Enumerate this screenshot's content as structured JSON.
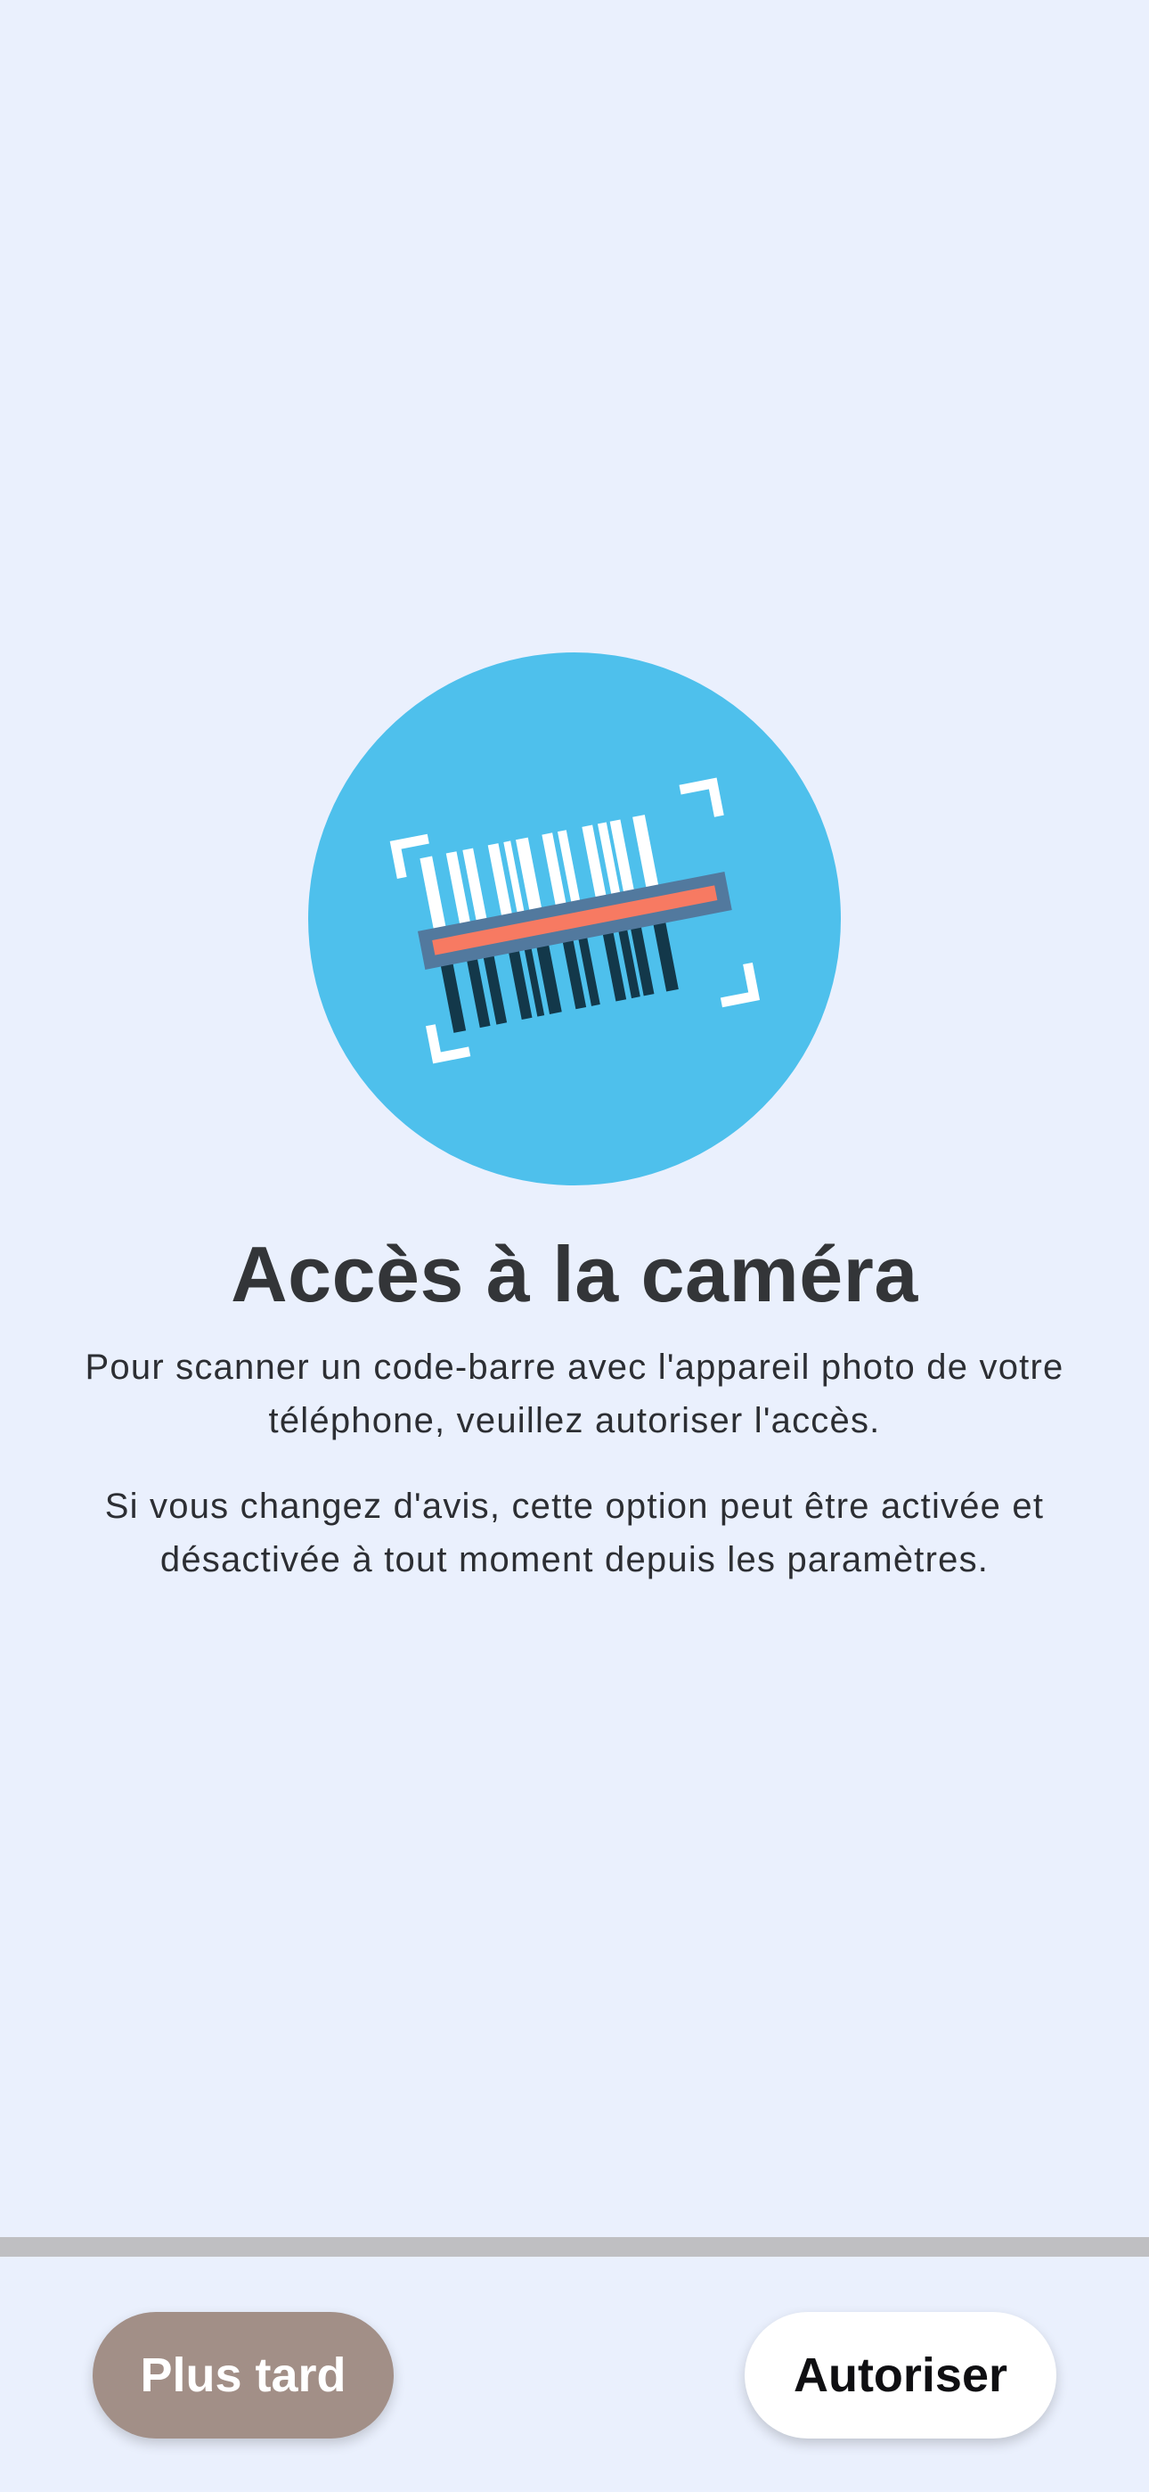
{
  "hero": {
    "icon": "barcode-scanner-icon",
    "circle_color": "#4ec0ec",
    "laser_color": "#f77a62",
    "bar_dark_color": "#13384a"
  },
  "permission": {
    "title": "Accès à la caméra",
    "paragraph_1": "Pour scanner un code-barre avec l'appareil photo de votre téléphone, veuillez autoriser l'accès.",
    "paragraph_2": "Si vous changez d'avis, cette option peut être activée et désactivée à tout moment depuis les paramètres."
  },
  "actions": {
    "later_label": "Plus tard",
    "allow_label": "Autoriser",
    "later_color": "#a28f87",
    "allow_color": "#ffffff"
  }
}
